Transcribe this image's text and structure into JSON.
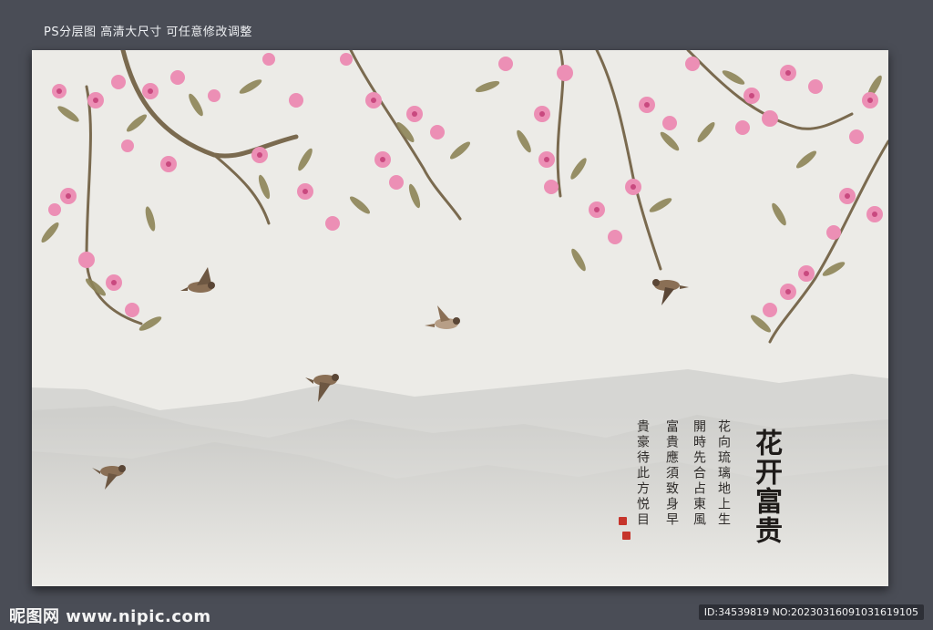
{
  "header": {
    "caption": "PS分层图 高清大尺寸 可任意修改调整"
  },
  "artwork": {
    "title": "花开富贵",
    "poem_columns": [
      "花向琉璃地上生",
      "開時先合占東風",
      "富貴應須致身早",
      "貴豪待此方悦目"
    ],
    "colors": {
      "background": "#ecebe7",
      "blossom": "#ec8fb5",
      "blossom_dark": "#c9497f",
      "leaf": "#8d8458",
      "branch": "#7a6a4f",
      "mountain": "#c9c9c6",
      "seal": "#c6342b"
    }
  },
  "footer": {
    "logo": "昵图网 www.nipic.com",
    "id_text": "ID:34539819 NO:20230316091031619105"
  }
}
